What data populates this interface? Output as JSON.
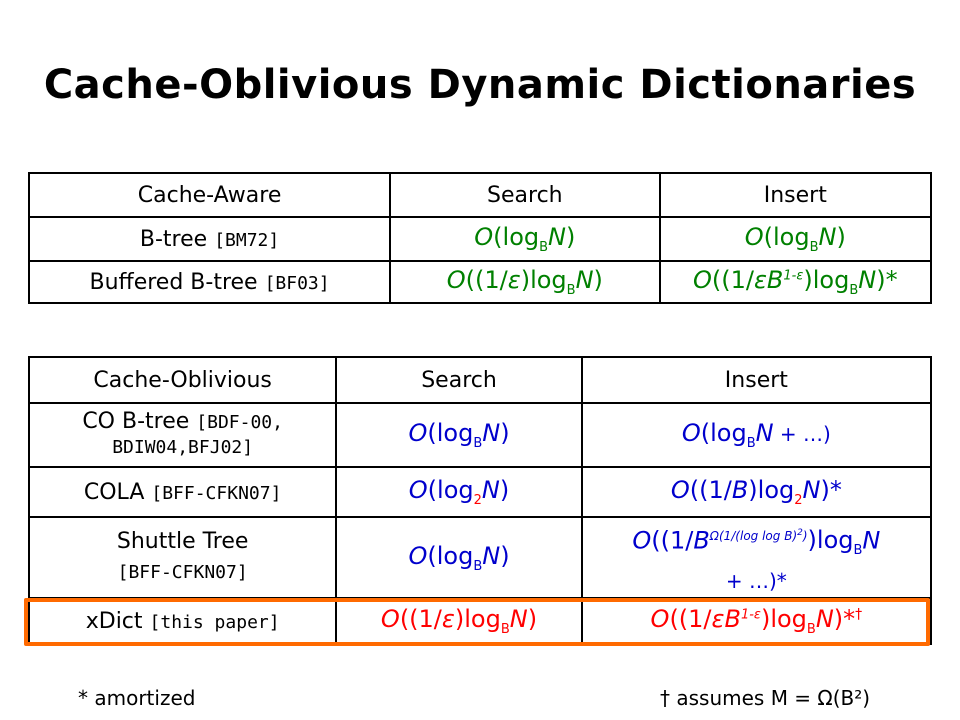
{
  "title": "Cache-Oblivious Dynamic Dictionaries",
  "aware_table": {
    "header": [
      "Cache-Aware",
      "Search",
      "Insert"
    ],
    "rows": [
      {
        "name": "B-tree",
        "cite": "[BM72]",
        "search": "O(log_B N)",
        "insert": "O(log_B N)"
      },
      {
        "name": "Buffered B-tree",
        "cite": "[BF03]",
        "search": "O((1/ε)log_B N)",
        "insert": "O((1/εB^(1-ε))log_B N)*"
      }
    ]
  },
  "oblivious_table": {
    "header": [
      "Cache-Oblivious",
      "Search",
      "Insert"
    ],
    "rows": [
      {
        "name": "CO B-tree",
        "cite_line1": "[BDF-00,",
        "cite_line2": "BDIW04,BFJ02]",
        "search": "O(log_B N)",
        "insert": "O(log_B N + …)"
      },
      {
        "name": "COLA",
        "cite": "[BFF-CFKN07]",
        "search": "O(log_2 N)",
        "insert": "O((1/B)log_2 N)*"
      },
      {
        "name": "Shuttle Tree",
        "cite": "[BFF-CFKN07]",
        "search": "O(log_B N)",
        "insert": "O((1/B^(Ω(1/(log log B)^2)))log_B N + …)*"
      },
      {
        "name": "xDict",
        "cite": "[this paper]",
        "search": "O((1/ε)log_B N)",
        "insert": "O((1/εB^(1-ε))log_B N)*†"
      }
    ]
  },
  "footnotes": {
    "left": "* amortized",
    "right": "† assumes M = Ω(B²)"
  },
  "colors": {
    "green": "#008000",
    "blue": "#0000cc",
    "red": "#ff0000",
    "highlight": "#ff6a00"
  }
}
